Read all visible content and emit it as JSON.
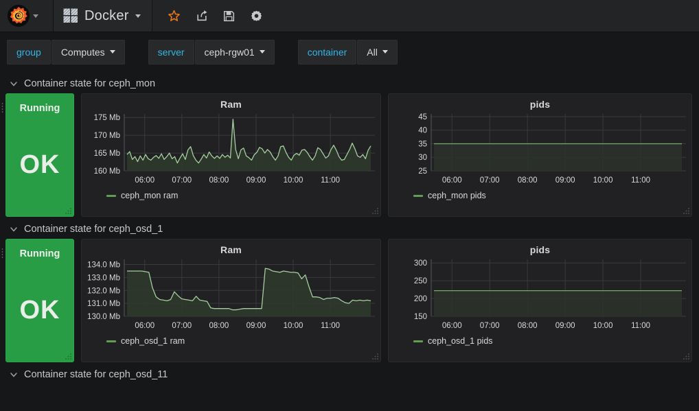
{
  "navbar": {
    "logo_icon": "grafana-logo-icon",
    "logo_caret_icon": "chevron-down-icon",
    "dashboard_icon": "dashboard-grid-icon",
    "dashboard_title": "Docker",
    "title_caret_icon": "chevron-down-icon",
    "tools": [
      {
        "name": "star-icon",
        "title": "Mark as favorite"
      },
      {
        "name": "share-icon",
        "title": "Share dashboard"
      },
      {
        "name": "save-icon",
        "title": "Save dashboard"
      },
      {
        "name": "gear-icon",
        "title": "Dashboard settings"
      }
    ]
  },
  "variables": [
    {
      "label": "group",
      "value": "Computes",
      "caret_icon": "caret-down-icon"
    },
    {
      "label": "server",
      "value": "ceph-rgw01",
      "caret_icon": "caret-down-icon"
    },
    {
      "label": "container",
      "value": "All",
      "caret_icon": "caret-down-icon"
    }
  ],
  "rows": [
    {
      "title": "Container state for ceph_mon",
      "chevron_icon": "chevron-down-icon",
      "stat": {
        "title": "Running",
        "value": "OK",
        "color": "#299c46"
      },
      "ram_panel_title": "Ram",
      "pids_panel_title": "pids",
      "ram_legend": "ceph_mon ram",
      "pids_legend": "ceph_mon pids"
    },
    {
      "title": "Container state for ceph_osd_1",
      "chevron_icon": "chevron-down-icon",
      "stat": {
        "title": "Running",
        "value": "OK",
        "color": "#299c46"
      },
      "ram_panel_title": "Ram",
      "pids_panel_title": "pids",
      "ram_legend": "ceph_osd_1 ram",
      "pids_legend": "ceph_osd_1 pids"
    },
    {
      "title": "Container state for ceph_osd_11",
      "chevron_icon": "chevron-down-icon"
    }
  ],
  "chart_data": [
    {
      "type": "line",
      "title": "Ram",
      "panel_id": "ceph_mon_ram",
      "xlabel": "",
      "ylabel": "",
      "grid": true,
      "legend": [
        "ceph_mon ram"
      ],
      "legend_position": "bottom-left",
      "line_color": "#a5cf9f",
      "fill_color": "#2e3a2b",
      "ylim": [
        160,
        176
      ],
      "yticks": [
        160,
        165,
        170,
        175
      ],
      "ytick_labels": [
        "160 Mb",
        "165 Mb",
        "170 Mb",
        "175 Mb"
      ],
      "xticks": [
        "06:00",
        "07:00",
        "08:00",
        "09:00",
        "10:00",
        "11:00"
      ],
      "xlim": [
        "05:45",
        "11:45"
      ],
      "series": [
        {
          "name": "ceph_mon ram",
          "values": [
            164.6,
            165.4,
            163.2,
            164.0,
            162.6,
            164.2,
            163.0,
            164.6,
            163.4,
            163.0,
            163.8,
            164.3,
            163.5,
            164.8,
            163.2,
            164.0,
            165.0,
            163.4,
            164.0,
            162.2,
            163.6,
            164.8,
            163.2,
            165.9,
            166.8,
            164.3,
            163.0,
            162.2,
            163.3,
            164.6,
            163.6,
            165.3,
            164.2,
            163.5,
            164.2,
            163.5,
            164.6,
            163.8,
            164.4,
            163.6,
            174.5,
            166.0,
            163.4,
            165.9,
            166.4,
            164.2,
            163.7,
            163.0,
            164.5,
            165.2,
            166.6,
            166.2,
            165.0,
            166.0,
            165.3,
            164.0,
            163.0,
            164.2,
            166.8,
            167.0,
            165.2,
            163.8,
            163.0,
            164.4,
            164.9,
            164.4,
            165.8,
            166.0,
            165.2,
            164.0,
            163.0,
            164.2,
            166.5,
            166.0,
            164.8,
            163.6,
            164.2,
            166.0,
            167.2,
            165.8,
            164.0,
            163.0,
            163.2,
            164.6,
            166.0,
            167.8,
            166.2,
            164.2,
            163.8,
            164.6,
            163.4,
            165.8,
            167.0
          ]
        }
      ]
    },
    {
      "type": "line",
      "title": "pids",
      "panel_id": "ceph_mon_pids",
      "xlabel": "",
      "ylabel": "",
      "grid": true,
      "legend": [
        "ceph_mon pids"
      ],
      "legend_position": "bottom-left",
      "line_color": "#7aaa68",
      "fill_color": "#2b332a",
      "ylim": [
        25,
        46
      ],
      "yticks": [
        25,
        30,
        35,
        40,
        45
      ],
      "ytick_labels": [
        "25",
        "30",
        "35",
        "40",
        "45"
      ],
      "xticks": [
        "06:00",
        "07:00",
        "08:00",
        "09:00",
        "10:00",
        "11:00"
      ],
      "xlim": [
        "05:45",
        "11:45"
      ],
      "series": [
        {
          "name": "ceph_mon pids",
          "constant": 35,
          "values": [
            35,
            35,
            35,
            35,
            35,
            35,
            35,
            35,
            35,
            35,
            35,
            35,
            35
          ]
        }
      ]
    },
    {
      "type": "line",
      "title": "Ram",
      "panel_id": "ceph_osd_1_ram",
      "xlabel": "",
      "ylabel": "",
      "grid": true,
      "legend": [
        "ceph_osd_1 ram"
      ],
      "legend_position": "bottom-left",
      "line_color": "#a5cf9f",
      "fill_color": "#2e3a2b",
      "ylim": [
        130.0,
        134.4
      ],
      "yticks": [
        130.0,
        131.0,
        132.0,
        133.0,
        134.0
      ],
      "ytick_labels": [
        "130.0 Mb",
        "131.0 Mb",
        "132.0 Mb",
        "133.0 Mb",
        "134.0 Mb"
      ],
      "xticks": [
        "06:00",
        "07:00",
        "08:00",
        "09:00",
        "10:00",
        "11:00"
      ],
      "xlim": [
        "05:45",
        "11:45"
      ],
      "series": [
        {
          "name": "ceph_osd_1 ram",
          "values": [
            133.5,
            133.5,
            133.5,
            133.5,
            133.5,
            133.45,
            133.4,
            132.2,
            131.5,
            131.3,
            131.25,
            131.2,
            131.3,
            131.9,
            131.6,
            131.35,
            131.3,
            131.25,
            131.2,
            131.55,
            131.25,
            131.2,
            131.15,
            130.65,
            130.6,
            130.6,
            130.6,
            130.6,
            130.6,
            130.5,
            130.5,
            130.55,
            130.6,
            130.6,
            130.6,
            130.6,
            130.6,
            130.6,
            133.7,
            133.65,
            133.5,
            133.45,
            133.4,
            133.5,
            133.45,
            133.4,
            133.4,
            133.35,
            132.9,
            133.2,
            132.3,
            131.5,
            131.5,
            131.45,
            131.3,
            131.4,
            131.4,
            131.45,
            131.4,
            131.2,
            131.05,
            131.0,
            131.25,
            131.2,
            131.25,
            131.2,
            131.25,
            131.2
          ]
        }
      ]
    },
    {
      "type": "line",
      "title": "pids",
      "panel_id": "ceph_osd_1_pids",
      "xlabel": "",
      "ylabel": "",
      "grid": true,
      "legend": [
        "ceph_osd_1 pids"
      ],
      "legend_position": "bottom-left",
      "line_color": "#7aaa68",
      "fill_color": "#2b332a",
      "ylim": [
        150,
        310
      ],
      "yticks": [
        150,
        200,
        250,
        300
      ],
      "ytick_labels": [
        "150",
        "200",
        "250",
        "300"
      ],
      "xticks": [
        "06:00",
        "07:00",
        "08:00",
        "09:00",
        "10:00",
        "11:00"
      ],
      "xlim": [
        "05:45",
        "11:45"
      ],
      "series": [
        {
          "name": "ceph_osd_1 pids",
          "constant": 222,
          "values": [
            222,
            222,
            222,
            222,
            222,
            222,
            222,
            222,
            222,
            222,
            222,
            222,
            222
          ]
        }
      ]
    }
  ]
}
